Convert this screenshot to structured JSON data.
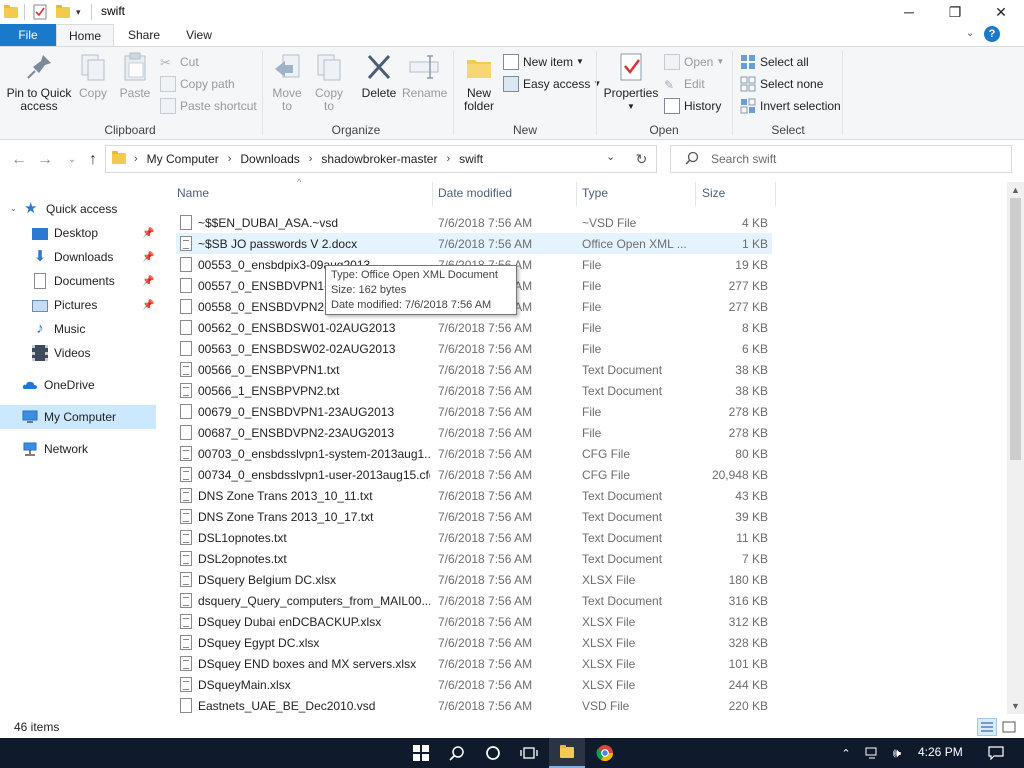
{
  "window": {
    "title": "swift",
    "controls": {
      "minimize": "─",
      "maximize": "❐",
      "close": "✕"
    }
  },
  "ribbon_tabs": [
    {
      "label": "File"
    },
    {
      "label": "Home"
    },
    {
      "label": "Share"
    },
    {
      "label": "View"
    }
  ],
  "ribbon": {
    "clipboard": {
      "group_label": "Clipboard",
      "pin_label_1": "Pin to Quick",
      "pin_label_2": "access",
      "copy_label": "Copy",
      "paste_label": "Paste",
      "cut_label": "Cut",
      "copy_path_label": "Copy path",
      "paste_shortcut_label": "Paste shortcut"
    },
    "organize": {
      "group_label": "Organize",
      "move_to_1": "Move",
      "move_to_2": "to",
      "copy_to_1": "Copy",
      "copy_to_2": "to",
      "delete_label": "Delete",
      "rename_label": "Rename"
    },
    "new": {
      "group_label": "New",
      "new_folder_1": "New",
      "new_folder_2": "folder",
      "new_item_label": "New item",
      "easy_access_label": "Easy access"
    },
    "open": {
      "group_label": "Open",
      "properties_label": "Properties",
      "open_label": "Open",
      "edit_label": "Edit",
      "history_label": "History"
    },
    "select": {
      "group_label": "Select",
      "select_all_label": "Select all",
      "select_none_label": "Select none",
      "invert_label": "Invert selection"
    }
  },
  "address": {
    "crumbs": [
      "My Computer",
      "Downloads",
      "shadowbroker-master",
      "swift"
    ],
    "search_placeholder": "Search swift"
  },
  "nav_pane": {
    "quick_access": "Quick access",
    "items": [
      {
        "label": "Desktop",
        "pinned": true
      },
      {
        "label": "Downloads",
        "pinned": true
      },
      {
        "label": "Documents",
        "pinned": true
      },
      {
        "label": "Pictures",
        "pinned": true
      },
      {
        "label": "Music",
        "pinned": false
      },
      {
        "label": "Videos",
        "pinned": false
      }
    ],
    "onedrive": "OneDrive",
    "my_computer": "My Computer",
    "network": "Network"
  },
  "columns": {
    "name": "Name",
    "date": "Date modified",
    "type": "Type",
    "size": "Size"
  },
  "files": [
    {
      "name": "~$$EN_DUBAI_ASA.~vsd",
      "date": "7/6/2018 7:56 AM",
      "type": "~VSD File",
      "size": "4 KB"
    },
    {
      "name": "~$SB JO passwords V 2.docx",
      "date": "7/6/2018 7:56 AM",
      "type": "Office Open XML ...",
      "size": "1 KB"
    },
    {
      "name": "00553_0_ensbdpix3-09aug2013",
      "date": "7/6/2018 7:56 AM",
      "type": "File",
      "size": "19 KB"
    },
    {
      "name": "00557_0_ENSBDVPN1-02",
      "date": "7/6/2018 7:56 AM",
      "type": "File",
      "size": "277 KB"
    },
    {
      "name": "00558_0_ENSBDVPN2-02",
      "date": "7/6/2018 7:56 AM",
      "type": "File",
      "size": "277 KB"
    },
    {
      "name": "00562_0_ENSBDSW01-02AUG2013",
      "date": "7/6/2018 7:56 AM",
      "type": "File",
      "size": "8 KB"
    },
    {
      "name": "00563_0_ENSBDSW02-02AUG2013",
      "date": "7/6/2018 7:56 AM",
      "type": "File",
      "size": "6 KB"
    },
    {
      "name": "00566_0_ENSBPVPN1.txt",
      "date": "7/6/2018 7:56 AM",
      "type": "Text Document",
      "size": "38 KB"
    },
    {
      "name": "00566_1_ENSBPVPN2.txt",
      "date": "7/6/2018 7:56 AM",
      "type": "Text Document",
      "size": "38 KB"
    },
    {
      "name": "00679_0_ENSBDVPN1-23AUG2013",
      "date": "7/6/2018 7:56 AM",
      "type": "File",
      "size": "278 KB"
    },
    {
      "name": "00687_0_ENSBDVPN2-23AUG2013",
      "date": "7/6/2018 7:56 AM",
      "type": "File",
      "size": "278 KB"
    },
    {
      "name": "00703_0_ensbdsslvpn1-system-2013aug1...",
      "date": "7/6/2018 7:56 AM",
      "type": "CFG File",
      "size": "80 KB"
    },
    {
      "name": "00734_0_ensbdsslvpn1-user-2013aug15.cfg",
      "date": "7/6/2018 7:56 AM",
      "type": "CFG File",
      "size": "20,948 KB"
    },
    {
      "name": "DNS Zone Trans 2013_10_11.txt",
      "date": "7/6/2018 7:56 AM",
      "type": "Text Document",
      "size": "43 KB"
    },
    {
      "name": "DNS Zone Trans 2013_10_17.txt",
      "date": "7/6/2018 7:56 AM",
      "type": "Text Document",
      "size": "39 KB"
    },
    {
      "name": "DSL1opnotes.txt",
      "date": "7/6/2018 7:56 AM",
      "type": "Text Document",
      "size": "11 KB"
    },
    {
      "name": "DSL2opnotes.txt",
      "date": "7/6/2018 7:56 AM",
      "type": "Text Document",
      "size": "7 KB"
    },
    {
      "name": "DSquery Belgium DC.xlsx",
      "date": "7/6/2018 7:56 AM",
      "type": "XLSX File",
      "size": "180 KB"
    },
    {
      "name": "dsquery_Query_computers_from_MAIL00...",
      "date": "7/6/2018 7:56 AM",
      "type": "Text Document",
      "size": "316 KB"
    },
    {
      "name": "DSquey Dubai enDCBACKUP.xlsx",
      "date": "7/6/2018 7:56 AM",
      "type": "XLSX File",
      "size": "312 KB"
    },
    {
      "name": "DSquey Egypt DC.xlsx",
      "date": "7/6/2018 7:56 AM",
      "type": "XLSX File",
      "size": "328 KB"
    },
    {
      "name": "DSquey END boxes and MX servers.xlsx",
      "date": "7/6/2018 7:56 AM",
      "type": "XLSX File",
      "size": "101 KB"
    },
    {
      "name": "DSqueyMain.xlsx",
      "date": "7/6/2018 7:56 AM",
      "type": "XLSX File",
      "size": "244 KB"
    },
    {
      "name": "Eastnets_UAE_BE_Dec2010.vsd",
      "date": "7/6/2018 7:56 AM",
      "type": "VSD File",
      "size": "220 KB"
    }
  ],
  "tooltip": {
    "line1": "Type: Office Open XML Document",
    "line2": "Size: 162 bytes",
    "line3": "Date modified: 7/6/2018 7:56 AM"
  },
  "status": {
    "item_count": "46 items"
  },
  "taskbar": {
    "clock": "4:26 PM"
  },
  "colors": {
    "file_tab": "#1979ca",
    "selection": "#cce8ff",
    "hover_row": "#e5f3ff",
    "taskbar": "#0f1a2d"
  }
}
